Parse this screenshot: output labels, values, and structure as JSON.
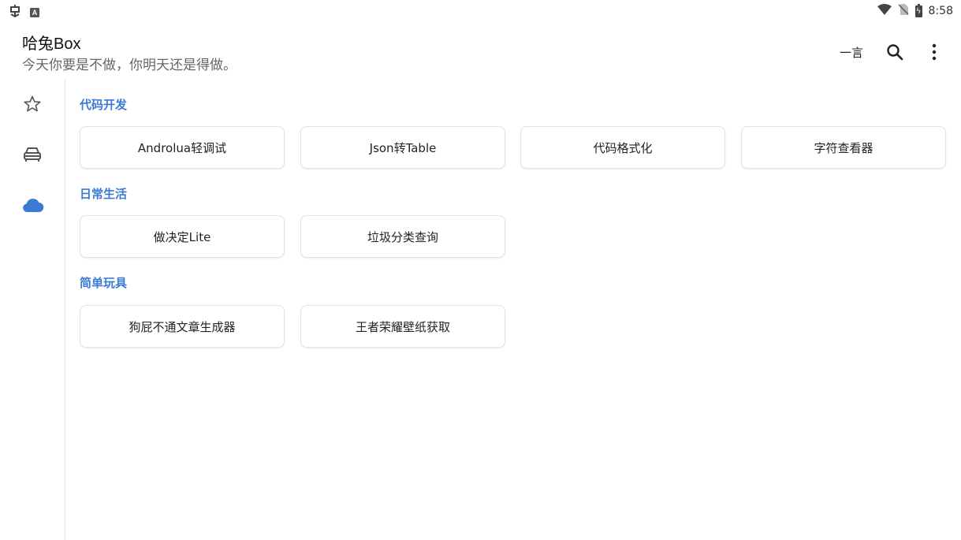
{
  "status_bar": {
    "left_icons": [
      "app-notification-icon",
      "a-badge-icon"
    ],
    "right_icons": [
      "wifi-icon",
      "no-sim-icon",
      "battery-charging-icon"
    ],
    "time": "8:58"
  },
  "header": {
    "title": "哈兔Box",
    "subtitle": "今天你要是不做，你明天还是得做。",
    "actions": {
      "quote_label": "一言",
      "search_icon": "search-icon",
      "more_icon": "more-vert-icon"
    }
  },
  "nav_rail": {
    "items": [
      {
        "icon": "star-outline-icon",
        "selected": false
      },
      {
        "icon": "car-icon",
        "selected": false
      },
      {
        "icon": "cloud-icon",
        "selected": true
      }
    ],
    "selected_color": "#3a7bd5"
  },
  "sections": [
    {
      "title": "代码开发",
      "items": [
        "Androlua轻调试",
        "Json转Table",
        "代码格式化",
        "字符查看器"
      ]
    },
    {
      "title": "日常生活",
      "items": [
        "做决定Lite",
        "垃圾分类查询"
      ]
    },
    {
      "title": "简单玩具",
      "items": [
        "狗屁不通文章生成器",
        "王者荣耀壁纸获取"
      ]
    }
  ],
  "colors": {
    "accent": "#3a7bd5",
    "section_title": "#3a7bd5"
  }
}
